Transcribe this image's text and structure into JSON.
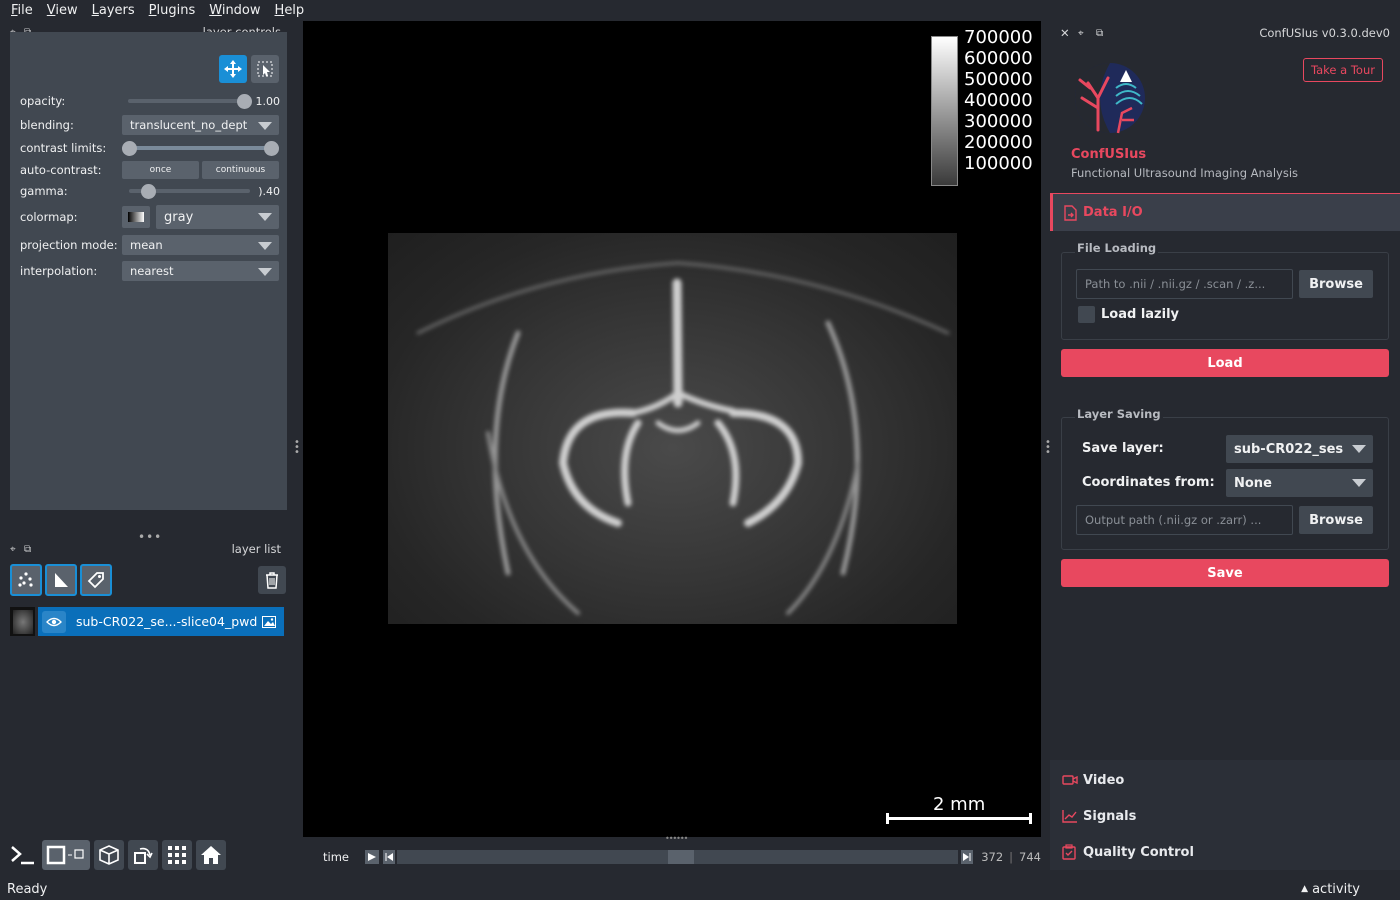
{
  "menu": [
    "File",
    "View",
    "Layers",
    "Plugins",
    "Window",
    "Help"
  ],
  "layer_controls": {
    "title": "layer controls",
    "opacity": {
      "label": "opacity:",
      "value": "1.00",
      "fraction": 1.0
    },
    "blending": {
      "label": "blending:",
      "value": "translucent_no_dept"
    },
    "contrast": {
      "label": "contrast limits:"
    },
    "auto_contrast": {
      "label": "auto-contrast:",
      "once": "once",
      "continuous": "continuous"
    },
    "gamma": {
      "label": "gamma:",
      "value": ").40",
      "fraction": 0.1
    },
    "colormap": {
      "label": "colormap:",
      "value": "gray"
    },
    "projection": {
      "label": "projection mode:",
      "value": "mean"
    },
    "interpolation": {
      "label": "interpolation:",
      "value": "nearest"
    }
  },
  "layer_list": {
    "title": "layer list",
    "layer_name": "sub-CR022_se...-slice04_pwd"
  },
  "canvas": {
    "colorbar_ticks": [
      "700000",
      "600000",
      "500000",
      "400000",
      "300000",
      "200000",
      "100000"
    ],
    "scalebar_label": "2 mm"
  },
  "time": {
    "label": "time",
    "current": "372",
    "total": "744",
    "fraction": 0.5
  },
  "plugin": {
    "header": "ConfUSIus v0.3.0.dev0",
    "tour_button": "Take a Tour",
    "name": "ConfUSIus",
    "subtitle": "Functional Ultrasound Imaging Analysis",
    "section_active": "Data I/O",
    "file_loading": {
      "title": "File Loading",
      "path_placeholder": "Path to .nii / .nii.gz / .scan / .z...",
      "browse": "Browse",
      "lazy": "Load lazily",
      "load": "Load"
    },
    "layer_saving": {
      "title": "Layer Saving",
      "save_layer_label": "Save layer:",
      "save_layer_value": "sub-CR022_ses",
      "coords_label": "Coordinates from:",
      "coords_value": "None",
      "output_placeholder": "Output path (.nii.gz or .zarr) ...",
      "browse": "Browse",
      "save": "Save"
    },
    "sections": [
      "Video",
      "Signals",
      "Quality Control"
    ]
  },
  "status": {
    "left": "Ready",
    "right": "activity"
  },
  "colors": {
    "accent": "#e8485f",
    "selection": "#0a6fba",
    "panel": "#414851",
    "background": "#262930"
  }
}
